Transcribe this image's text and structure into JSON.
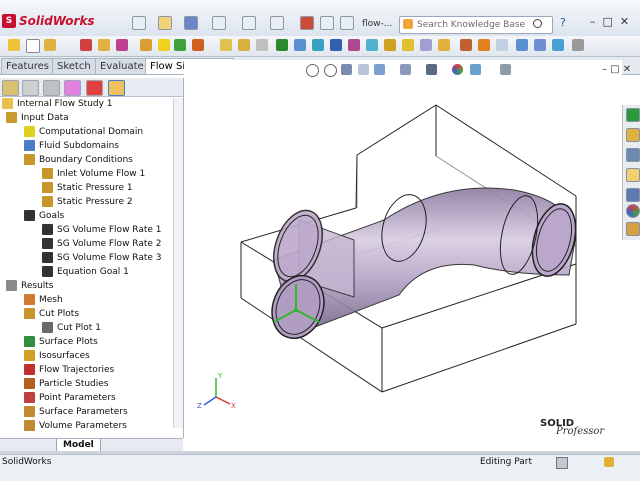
{
  "app": {
    "name": "SolidWorks",
    "document": "flow-..."
  },
  "search": {
    "placeholder": "Search Knowledge Base"
  },
  "tabs": [
    {
      "label": "Features"
    },
    {
      "label": "Sketch"
    },
    {
      "label": "Evaluate"
    },
    {
      "label": "Flow Simulation",
      "active": true
    }
  ],
  "tree": {
    "root": "Internal Flow Study 1",
    "items": [
      {
        "label": "Input Data",
        "level": 1,
        "icon": "input-data-icon",
        "color": "#c79b2e"
      },
      {
        "label": "Computational Domain",
        "level": 2,
        "icon": "domain-icon",
        "color": "#e0d020"
      },
      {
        "label": "Fluid Subdomains",
        "level": 2,
        "icon": "subdomain-icon",
        "color": "#4a7cc9"
      },
      {
        "label": "Boundary Conditions",
        "level": 2,
        "icon": "boundary-icon",
        "color": "#c8962a"
      },
      {
        "label": "Inlet Volume Flow 1",
        "level": 3,
        "icon": "boundary-item-icon",
        "color": "#c8962a"
      },
      {
        "label": "Static Pressure 1",
        "level": 3,
        "icon": "boundary-item-icon",
        "color": "#c8962a"
      },
      {
        "label": "Static Pressure 2",
        "level": 3,
        "icon": "boundary-item-icon",
        "color": "#c8962a"
      },
      {
        "label": "Goals",
        "level": 2,
        "icon": "goals-icon",
        "color": "#333333"
      },
      {
        "label": "SG Volume Flow Rate 1",
        "level": 3,
        "icon": "goal-flag-icon",
        "color": "#333333"
      },
      {
        "label": "SG Volume Flow Rate 2",
        "level": 3,
        "icon": "goal-flag-icon",
        "color": "#333333"
      },
      {
        "label": "SG Volume Flow Rate 3",
        "level": 3,
        "icon": "goal-flag-icon",
        "color": "#333333"
      },
      {
        "label": "Equation Goal 1",
        "level": 3,
        "icon": "goal-flag-icon",
        "color": "#333333"
      },
      {
        "label": "Results",
        "level": 1,
        "icon": "results-icon",
        "color": "#8a8a8a"
      },
      {
        "label": "Mesh",
        "level": 2,
        "icon": "mesh-icon",
        "color": "#d07a30"
      },
      {
        "label": "Cut Plots",
        "level": 2,
        "icon": "cut-plots-icon",
        "color": "#c8962a"
      },
      {
        "label": "Cut Plot 1",
        "level": 3,
        "icon": "cut-plot-icon",
        "color": "#6a6a6a"
      },
      {
        "label": "Surface Plots",
        "level": 2,
        "icon": "surface-plots-icon",
        "color": "#2f8f3a"
      },
      {
        "label": "Isosurfaces",
        "level": 2,
        "icon": "isosurfaces-icon",
        "color": "#d0a020"
      },
      {
        "label": "Flow Trajectories",
        "level": 2,
        "icon": "trajectories-icon",
        "color": "#c03030"
      },
      {
        "label": "Particle Studies",
        "level": 2,
        "icon": "particle-icon",
        "color": "#b06020"
      },
      {
        "label": "Point Parameters",
        "level": 2,
        "icon": "point-params-icon",
        "color": "#c04040"
      },
      {
        "label": "Surface Parameters",
        "level": 2,
        "icon": "surface-params-icon",
        "color": "#c08a30"
      },
      {
        "label": "Volume Parameters",
        "level": 2,
        "icon": "volume-params-icon",
        "color": "#c08a30"
      }
    ]
  },
  "bottom_tab": "Model",
  "status": {
    "left": "SolidWorks",
    "mode": "Editing Part"
  },
  "watermark": {
    "line1": "SOLID",
    "line2": "Professor"
  },
  "colors": {
    "accent": "#c8102e",
    "pipe": "#b9a8c6"
  }
}
